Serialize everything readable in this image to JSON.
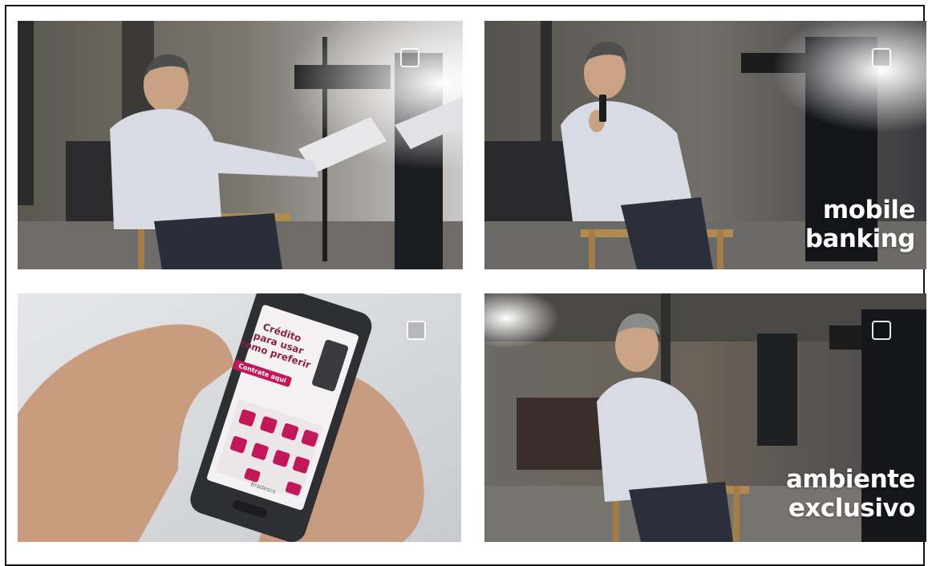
{
  "panels": [
    {
      "id": "panel-1",
      "caption": []
    },
    {
      "id": "panel-2",
      "caption": [
        "mobile",
        "banking"
      ]
    },
    {
      "id": "panel-3",
      "caption": [],
      "phone_screen": {
        "headline": [
          "Crédito",
          "para usar",
          "como preferir"
        ],
        "button": "Contrate aqui",
        "brand": "Bradesco"
      }
    },
    {
      "id": "panel-4",
      "caption": [
        "ambiente",
        "exclusivo"
      ]
    }
  ],
  "logo_icon": "bank-logo-icon",
  "colors": {
    "brand": "#c2185b",
    "caption_text": "#ffffff"
  }
}
